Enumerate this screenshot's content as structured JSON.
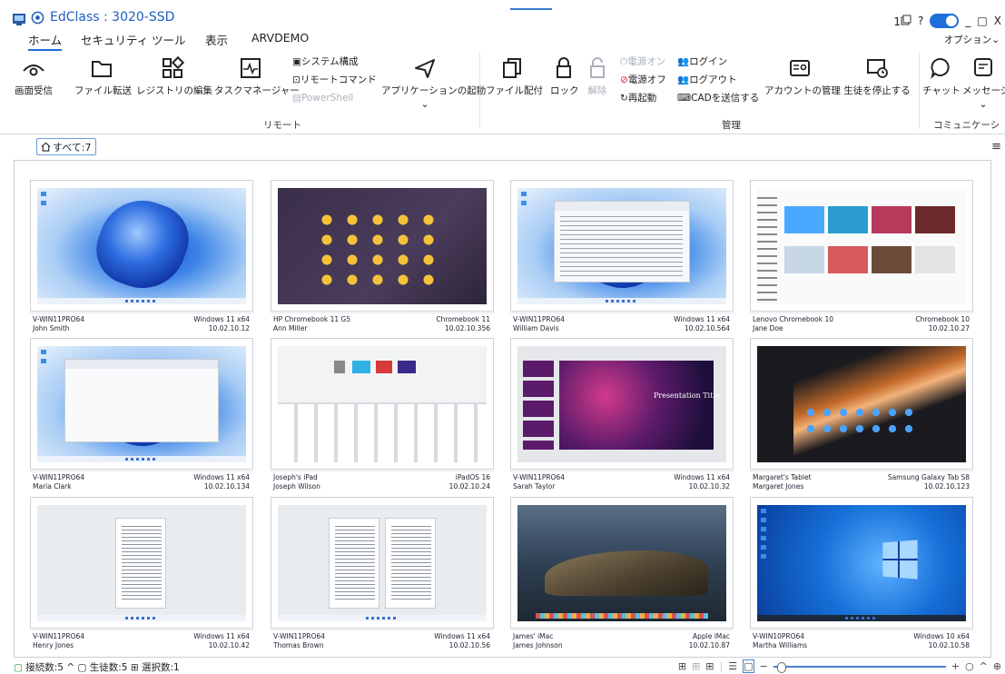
{
  "app": {
    "title": "EdClass : 3020-SSD",
    "notification_count": "1",
    "help": "?",
    "window_controls": [
      "_",
      "□",
      "X"
    ]
  },
  "menu": {
    "tabs": [
      "ホーム",
      "セキュリティ",
      "ツール",
      "表示",
      "ARVDEMO"
    ],
    "options": "オプション"
  },
  "ribbon": {
    "remote": {
      "group_label": "リモート",
      "screen_receive": "画面受信",
      "file_transfer": "ファイル転送",
      "registry_edit": "レジストリの編集",
      "task_manager": "タスクマネージャー",
      "system_config": "システム構成",
      "remote_command": "リモートコマンド",
      "powershell": "PowerShell",
      "app_launch": "アプリケーションの起動"
    },
    "manage": {
      "group_label": "管理",
      "file_distribute": "ファイル配付",
      "lock": "ロック",
      "unlock": "解除",
      "power_on": "電源オン",
      "power_off": "電源オフ",
      "restart": "再起動",
      "login": "ログイン",
      "logout": "ログアウト",
      "send_cad": "CADを送信する",
      "account_manage": "アカウントの管理",
      "stop_student": "生徒を停止する"
    },
    "communication": {
      "group_label": "コミュニケーション",
      "chat": "チャット",
      "message": "メッセージ"
    }
  },
  "filter": {
    "all_chip": "すべて:7"
  },
  "cards": [
    {
      "host": "V-WIN11PRO64",
      "user": "John Smith",
      "os": "Windows 11 x64",
      "ip": "10.02.10.12"
    },
    {
      "host": "HP Chromebook 11 G5",
      "user": "Ann Miller",
      "os": "Chromebook 11",
      "ip": "10.02.10.356"
    },
    {
      "host": "V-WIN11PRO64",
      "user": "William Davis",
      "os": "Windows 11 x64",
      "ip": "10.02.10.564"
    },
    {
      "host": "Lenovo Chromebook 10",
      "user": "Jane Doe",
      "os": "Chromebook 10",
      "ip": "10.02.10.27"
    },
    {
      "host": "V-WIN11PRO64",
      "user": "Maria Clark",
      "os": "Windows 11 x64",
      "ip": "10.02.10.134"
    },
    {
      "host": "Joseph's iPad",
      "user": "Joseph Wilson",
      "os": "iPadOS 16",
      "ip": "10.02.10.24"
    },
    {
      "host": "V-WIN11PRO64",
      "user": "Sarah Taylor",
      "os": "Windows 11 x64",
      "ip": "10.02.10.32"
    },
    {
      "host": "Margaret's Tablet",
      "user": "Margaret Jones",
      "os": "Samsung Galaxy Tab S8",
      "ip": "10.02.10.123"
    },
    {
      "host": "V-WIN11PRO64",
      "user": "Henry Jones",
      "os": "Windows 11 x64",
      "ip": "10.02.10.42"
    },
    {
      "host": "V-WIN11PRO64",
      "user": "Thomas Brown",
      "os": "Windows 11 x64",
      "ip": "10.02.10.56"
    },
    {
      "host": "James' iMac",
      "user": "James Johnson",
      "os": "Apple iMac",
      "ip": "10.02.10.87"
    },
    {
      "host": "V-WIN10PRO64",
      "user": "Martha Williams",
      "os": "Windows 10 x64",
      "ip": "10.02.10.58"
    }
  ],
  "screens": {
    "ppt_title": "Presentation Title"
  },
  "status": {
    "connected": "接続数:5",
    "students": "生徒数:5",
    "selected": "選択数:1"
  },
  "colors": {
    "accent": "#1e6fd9",
    "title": "#1e5fbf"
  }
}
